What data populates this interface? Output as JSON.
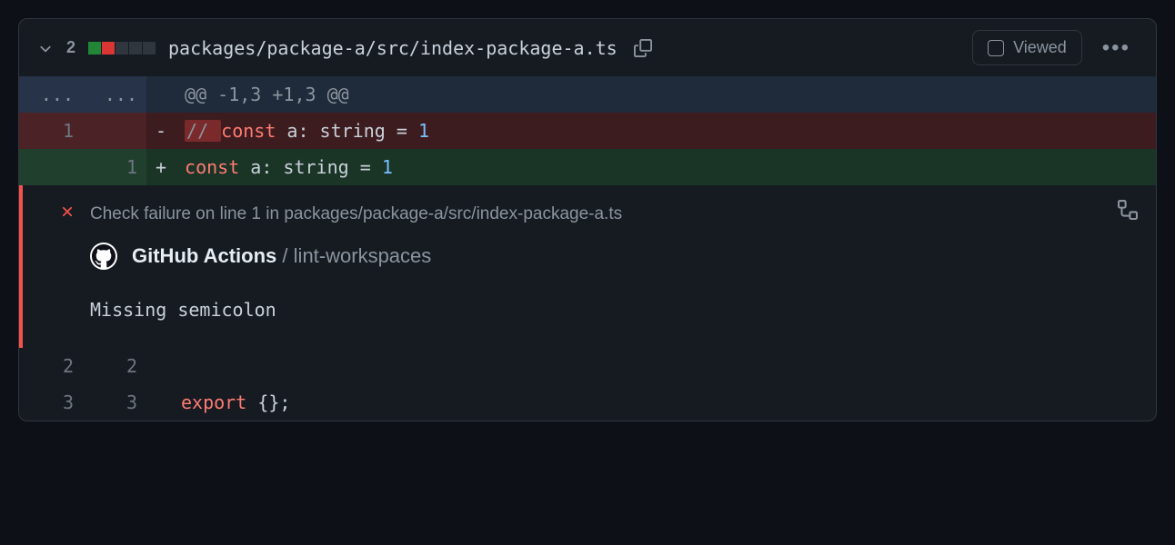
{
  "header": {
    "change_count": "2",
    "file_path": "packages/package-a/src/index-package-a.ts",
    "viewed_label": "Viewed"
  },
  "hunk": {
    "header": "@@ -1,3 +1,3 @@"
  },
  "lines": {
    "del": {
      "old_num": "1",
      "marker": "-",
      "comment_prefix": "// ",
      "kw": "const",
      "rest1": " a: string = ",
      "num": "1"
    },
    "add": {
      "new_num": "1",
      "marker": "+",
      "kw": "const",
      "rest1": " a: string = ",
      "num": "1"
    },
    "ctx1": {
      "old_num": "2",
      "new_num": "2",
      "text": ""
    },
    "ctx2": {
      "old_num": "3",
      "new_num": "3",
      "kw": "export",
      "rest": " {};"
    }
  },
  "annotation": {
    "summary": "Check failure on line 1 in packages/package-a/src/index-package-a.ts",
    "source_app": "GitHub Actions",
    "source_sep": "/",
    "source_job": "lint-workspaces",
    "message": "Missing semicolon"
  },
  "ellipsis": "...",
  "dots": "•••"
}
